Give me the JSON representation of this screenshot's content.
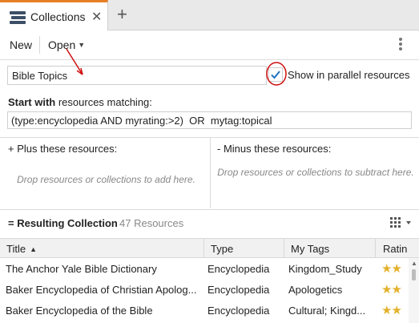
{
  "tabs": [
    {
      "label": "Collections",
      "icon": "collections-icon",
      "active": true
    }
  ],
  "toolbar": {
    "new_label": "New",
    "open_label": "Open"
  },
  "collection": {
    "name": "Bible Topics",
    "show_parallel_label": "Show in parallel resources",
    "show_parallel_checked": true
  },
  "start": {
    "label_bold": "Start with",
    "label_rest": " resources matching:",
    "query": "(type:encyclopedia AND myrating:>2)  OR  mytag:topical"
  },
  "plus": {
    "label": "+  Plus these resources:",
    "hint": "Drop resources or collections to add here."
  },
  "minus": {
    "label": "-  Minus these resources:",
    "hint": "Drop resources or collections to subtract here."
  },
  "result": {
    "label": "= Resulting Collection",
    "count": "47 Resources"
  },
  "grid": {
    "columns": [
      "Title",
      "Type",
      "My Tags",
      "Ratin"
    ],
    "rows": [
      {
        "title": "The Anchor Yale Bible Dictionary",
        "type": "Encyclopedia",
        "tags": "Kingdom_Study",
        "rating": "★★"
      },
      {
        "title": "Baker Encyclopedia of Christian Apolog...",
        "type": "Encyclopedia",
        "tags": "Apologetics",
        "rating": "★★"
      },
      {
        "title": "Baker Encyclopedia of the Bible",
        "type": "Encyclopedia",
        "tags": "Cultural; Kingd...",
        "rating": "★★"
      }
    ]
  },
  "colors": {
    "tab_accent": "#e77f25",
    "check_blue": "#1e73be",
    "annotation_red": "#d01010",
    "star_gold": "#e3b12c"
  }
}
